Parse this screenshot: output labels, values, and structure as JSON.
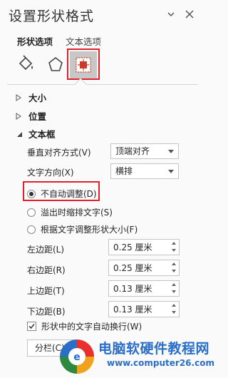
{
  "pane": {
    "title": "设置形状格式",
    "tabs": [
      {
        "label": "形状选项",
        "active": true
      },
      {
        "label": "文本选项",
        "active": false
      }
    ],
    "icons": [
      "fill-bucket-icon",
      "pentagon-icon",
      "text-box-icon"
    ],
    "active_icon": "text-box-icon"
  },
  "sections": {
    "size": "大小",
    "position": "位置",
    "textbox": "文本框"
  },
  "textbox": {
    "vertical_align_label": "垂直对齐方式(V)",
    "vertical_align_value": "顶端对齐",
    "text_direction_label": "文字方向(X)",
    "text_direction_value": "横排",
    "autofit_options": [
      {
        "label": "不自动调整(D)",
        "selected": true
      },
      {
        "label": "溢出时缩排文字(S)",
        "selected": false
      },
      {
        "label": "根据文字调整形状大小(F)",
        "selected": false
      }
    ],
    "margins": [
      {
        "label": "左边距(L)",
        "value": "0.25 厘米"
      },
      {
        "label": "右边距(R)",
        "value": "0.25 厘米"
      },
      {
        "label": "上边距(T)",
        "value": "0.13 厘米"
      },
      {
        "label": "下边距(B)",
        "value": "0.13 厘米"
      }
    ],
    "wrap_label": "形状中的文字自动换行(W)",
    "wrap_checked": true,
    "columns_label": "分栏(C)..."
  },
  "watermark": {
    "text": "电脑软硬件教程网",
    "url": "www.computer26.com"
  },
  "colors": {
    "highlight": "#e0202a",
    "accent": "#2a6ec8"
  }
}
